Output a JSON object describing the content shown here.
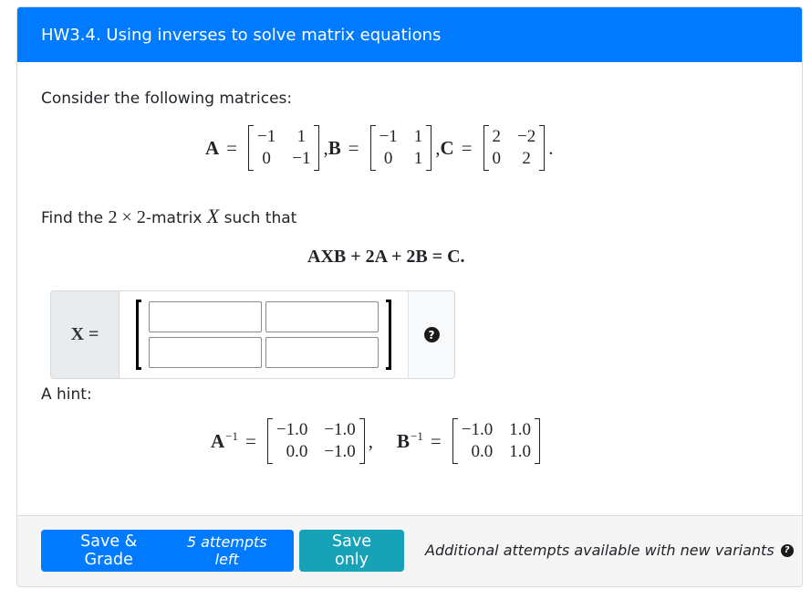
{
  "header": {
    "title": "HW3.4. Using inverses to solve matrix equations"
  },
  "question": {
    "intro": "Consider the following matrices:",
    "matrices": [
      {
        "name": "A",
        "rows": [
          [
            "−1",
            "1"
          ],
          [
            "0",
            "−1"
          ]
        ],
        "sep": ","
      },
      {
        "name": "B",
        "rows": [
          [
            "−1",
            "1"
          ],
          [
            "0",
            "1"
          ]
        ],
        "sep": ","
      },
      {
        "name": "C",
        "rows": [
          [
            "2",
            "−2"
          ],
          [
            "0",
            "2"
          ]
        ],
        "sep": "."
      }
    ],
    "find_text_pre": "Find the ",
    "find_math": "2 × 2",
    "find_text_mid": "-matrix ",
    "find_var": "X",
    "find_text_post": " such that",
    "equation": "AXB + 2A + 2B = C.",
    "answer_label": "X =",
    "answer_cells": [
      {
        "value": "",
        "placeholder": ""
      },
      {
        "value": "",
        "placeholder": ""
      },
      {
        "value": "",
        "placeholder": ""
      },
      {
        "value": "",
        "placeholder": ""
      }
    ],
    "help_icon": "question-circle-icon",
    "hint_label": "A hint:",
    "hint_matrices": [
      {
        "name": "A",
        "sup": "−1",
        "rows": [
          [
            "−1.0",
            "−1.0"
          ],
          [
            "0.0",
            "−1.0"
          ]
        ],
        "sep": ","
      },
      {
        "name": "B",
        "sup": "−1",
        "rows": [
          [
            "−1.0",
            "1.0"
          ],
          [
            "0.0",
            "1.0"
          ]
        ],
        "sep": ""
      }
    ]
  },
  "footer": {
    "save_grade_label": "Save & Grade",
    "attempts_left": "5 attempts left",
    "save_only_label": "Save only",
    "note": "Additional attempts available with new variants",
    "note_icon": "question-circle-icon"
  },
  "colors": {
    "primary": "#007bff",
    "info": "#17a2b8",
    "footer_bg": "#f5f5f5",
    "prepend_bg": "#e9ecef"
  }
}
